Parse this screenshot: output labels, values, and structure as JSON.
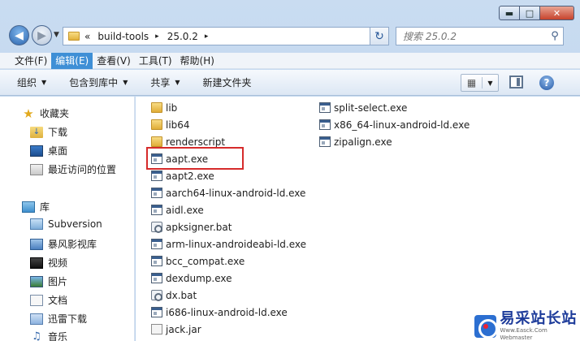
{
  "navigation": {
    "back_glyph": "◀",
    "forward_glyph": "▶",
    "dropdown_glyph": "▼"
  },
  "address": {
    "overflow": "«",
    "crumbs": [
      "build-tools",
      "25.0.2"
    ],
    "separator": "▸",
    "dropdown_glyph": "▼",
    "refresh_glyph": "↻"
  },
  "search": {
    "placeholder": "搜索 25.0.2",
    "icon": "search-icon"
  },
  "window_controls": {
    "minimize": "▬",
    "maximize": "□",
    "close": "✕"
  },
  "menu": [
    {
      "label": "文件(F)",
      "active": false
    },
    {
      "label": "编辑(E)",
      "active": true
    },
    {
      "label": "查看(V)",
      "active": false
    },
    {
      "label": "工具(T)",
      "active": false
    },
    {
      "label": "帮助(H)",
      "active": false
    }
  ],
  "commands": {
    "organize": "组织",
    "include_in_library": "包含到库中",
    "share": "共享",
    "new_folder": "新建文件夹",
    "caret": "▼",
    "view_glyph": "▦",
    "help_glyph": "?"
  },
  "sidebar": {
    "favorites": {
      "title": "收藏夹",
      "items": [
        "下载",
        "桌面",
        "最近访问的位置"
      ]
    },
    "libraries": {
      "title": "库",
      "items": [
        "Subversion",
        "暴风影视库",
        "视频",
        "图片",
        "文档",
        "迅雷下载",
        "音乐"
      ]
    }
  },
  "files": {
    "column1": [
      {
        "name": "lib",
        "type": "folder"
      },
      {
        "name": "lib64",
        "type": "folder"
      },
      {
        "name": "renderscript",
        "type": "folder"
      },
      {
        "name": "aapt.exe",
        "type": "exe"
      },
      {
        "name": "aapt2.exe",
        "type": "exe"
      },
      {
        "name": "aarch64-linux-android-ld.exe",
        "type": "exe"
      },
      {
        "name": "aidl.exe",
        "type": "exe"
      },
      {
        "name": "apksigner.bat",
        "type": "bat"
      },
      {
        "name": "arm-linux-androideabi-ld.exe",
        "type": "exe"
      },
      {
        "name": "bcc_compat.exe",
        "type": "exe"
      },
      {
        "name": "dexdump.exe",
        "type": "exe"
      },
      {
        "name": "dx.bat",
        "type": "bat"
      },
      {
        "name": "i686-linux-android-ld.exe",
        "type": "exe"
      },
      {
        "name": "jack.jar",
        "type": "jar"
      }
    ],
    "column2": [
      {
        "name": "split-select.exe",
        "type": "exe"
      },
      {
        "name": "x86_64-linux-android-ld.exe",
        "type": "exe"
      },
      {
        "name": "zipalign.exe",
        "type": "exe"
      }
    ]
  },
  "watermark": {
    "cn": "易采站长站",
    "en": "Www.Easck.Com Webmaster"
  }
}
